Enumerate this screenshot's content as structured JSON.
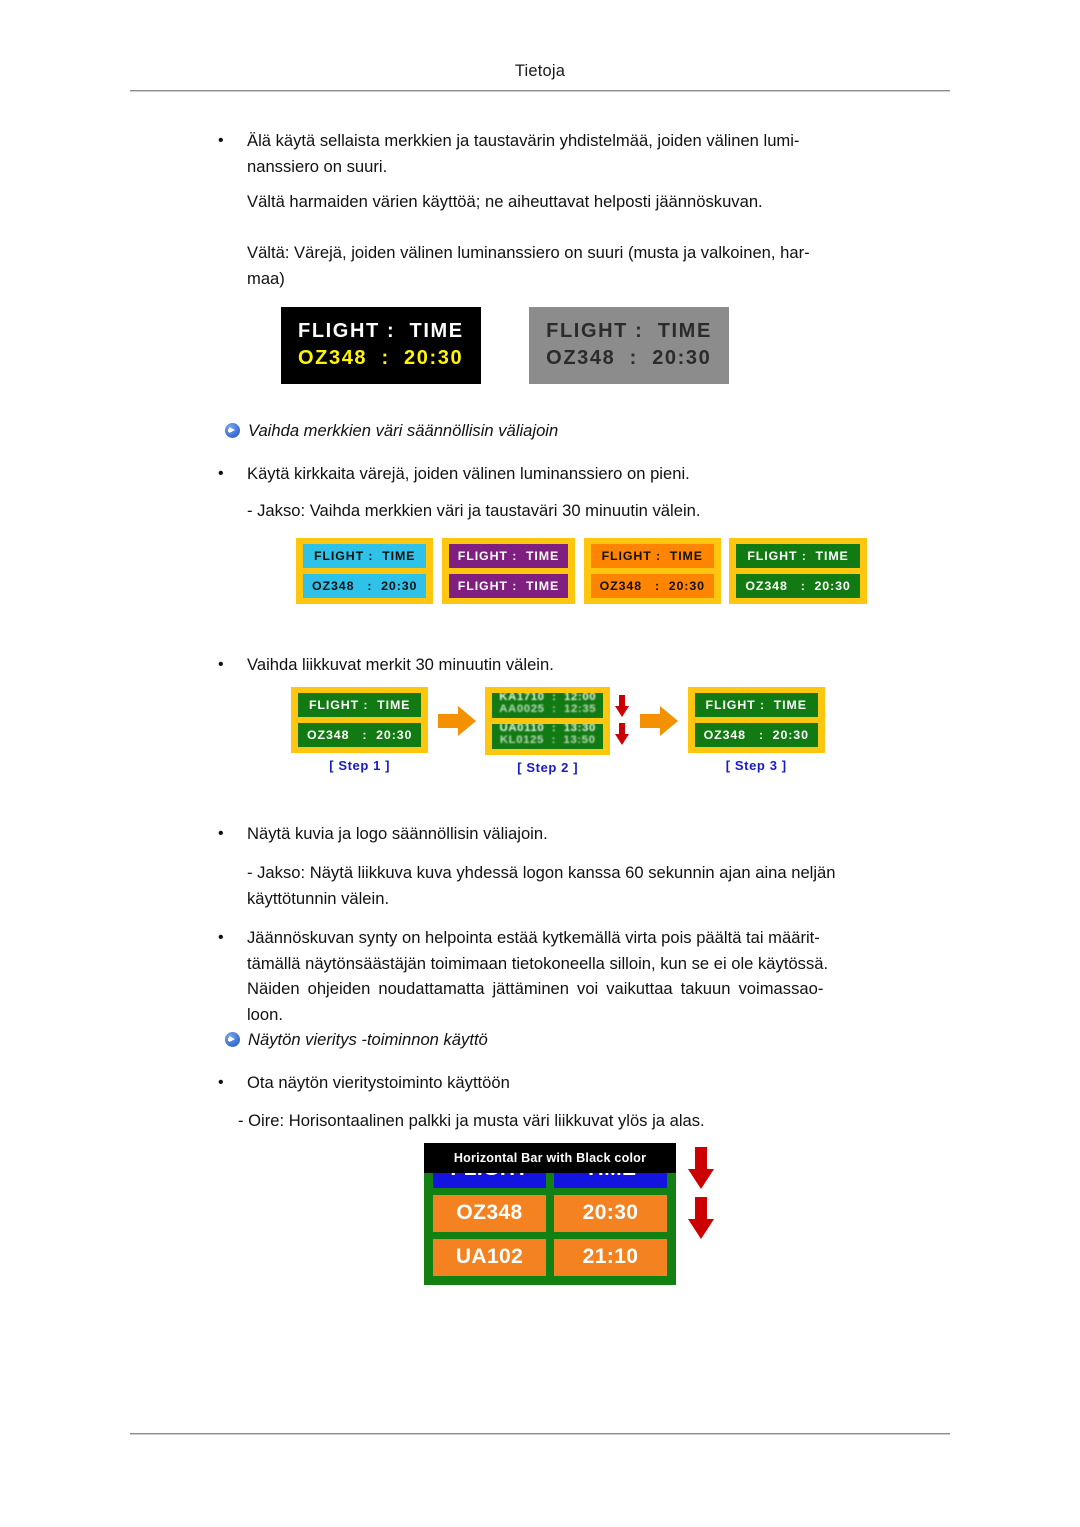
{
  "header": {
    "title": "Tietoja"
  },
  "footer": {
    "rule": true
  },
  "paragraphs": {
    "p1_line1": "Älä käytä sellaista merkkien ja taustavärin yhdistelmää, joiden välinen lumi-",
    "p1_line2": "nanssiero on suuri.",
    "p2": "Vältä harmaiden värien käyttöä; ne aiheuttavat helposti jäännöskuvan.",
    "p3_line1": "Vältä: Värejä, joiden välinen luminanssiero on suuri (musta ja valkoinen, har-",
    "p3_line2": "maa)",
    "p4": "Käytä kirkkaita värejä, joiden välinen luminanssiero on pieni.",
    "p5": "- Jakso: Vaihda merkkien väri ja taustaväri 30 minuutin välein.",
    "p6": "Vaihda liikkuvat merkit 30 minuutin välein.",
    "p7": "Näytä kuvia ja logo säännöllisin väliajoin.",
    "p8_line1": "- Jakso: Näytä liikkuva kuva yhdessä logon kanssa 60 sekunnin ajan aina neljän",
    "p8_line2": "käyttötunnin välein.",
    "p9_line1": "Jäännöskuvan synty on helpointa estää kytkemällä virta pois päältä tai määrit-",
    "p9_line2": "tämällä näytönsäästäjän toimimaan tietokoneella silloin, kun se ei ole käytössä.",
    "p9_line3": "Näiden ohjeiden noudattamatta jättäminen voi vaikuttaa takuun voimassao-",
    "p9_line4": "loon.",
    "p10": "Ota näytön vieritystoiminto käyttöön",
    "p11": "- Oire: Horisontaalinen palkki ja musta väri liikkuvat ylös ja alas."
  },
  "bullets": {
    "dot": "•"
  },
  "headings": {
    "h1": "Vaihda merkkien väri säännöllisin väliajoin",
    "h2": "Näytön vieritys -toiminnon käyttö"
  },
  "figure1": {
    "black_panel": {
      "row1": "FLIGHT :  TIME",
      "row2": "OZ348  :  20:30",
      "bg": "#000000",
      "row1_color": "#FFFFFF",
      "row2_color": "#FFF500"
    },
    "gray_panel": {
      "row1": "FLIGHT :  TIME",
      "row2": "OZ348  :  20:30",
      "bg": "#8C8C8C",
      "text_color": "#2B2B2B"
    }
  },
  "figure2": {
    "border_color": "#FFC610",
    "panels": [
      {
        "name": "cyan",
        "bg": "#2EC2E8",
        "fg": "#101010",
        "row1": "FLIGHT :  TIME",
        "row2": "OZ348   :  20:30"
      },
      {
        "name": "purple",
        "bg": "#7F1F7F",
        "fg": "#FFFFFF",
        "row1": "FLIGHT :  TIME",
        "row2": "FLIGHT :  TIME"
      },
      {
        "name": "orange",
        "bg": "#FF8400",
        "fg": "#101010",
        "row1": "FLIGHT :  TIME",
        "row2": "OZ348   :  20:30"
      },
      {
        "name": "green",
        "bg": "#127A12",
        "fg": "#FFFFFF",
        "row1": "FLIGHT :  TIME",
        "row2": "OZ348   :  20:30"
      }
    ]
  },
  "figure3": {
    "step1": {
      "label": "[ Step 1 ]",
      "row1": "FLIGHT :  TIME",
      "row2": "OZ348   :  20:30"
    },
    "step2": {
      "label": "[ Step 2 ]",
      "scroll_top": [
        "KA1710  :  12:00",
        "AA0025  :  12:35"
      ],
      "scroll_bottom": [
        "UA0110  :  13:30",
        "KL0125  :  13:50"
      ]
    },
    "step3": {
      "label": "[ Step 3 ]",
      "row1": "FLIGHT :  TIME",
      "row2": "OZ348   :  20:30"
    },
    "arrow_color": "#F59100",
    "red_arrow_color": "#CC0000"
  },
  "figure4": {
    "bar_label": "Horizontal Bar with Black color",
    "frame_color": "#138013",
    "header_bg": "#1414E0",
    "data_bg": "#F58220",
    "rows": [
      {
        "left": "FLIGHT",
        "right": "TIME"
      },
      {
        "left": "OZ348",
        "right": "20:30"
      },
      {
        "left": "UA102",
        "right": "21:10"
      }
    ],
    "arrow_color": "#CC0000"
  }
}
